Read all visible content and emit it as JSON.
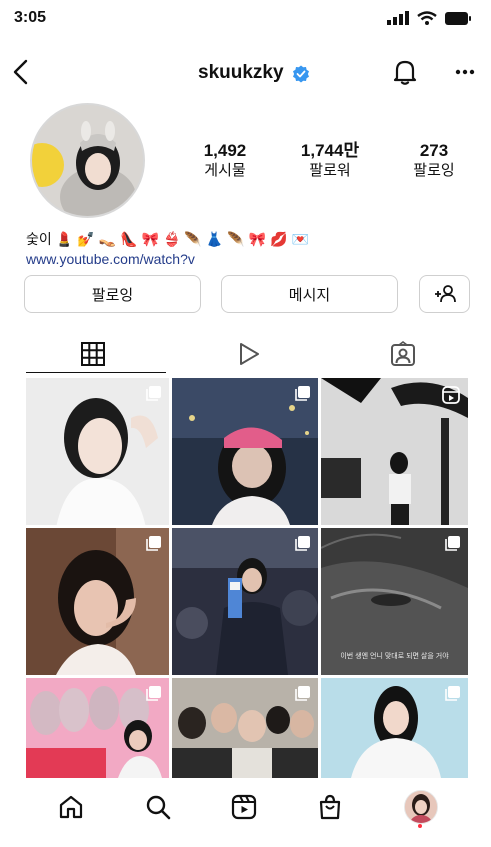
{
  "status_bar": {
    "time": "3:05"
  },
  "header": {
    "username": "skuukzky"
  },
  "profile": {
    "stats": [
      {
        "value": "1,492",
        "label": "게시물"
      },
      {
        "value": "1,744만",
        "label": "팔로워"
      },
      {
        "value": "273",
        "label": "팔로잉"
      }
    ],
    "bio_name": "숯이",
    "bio_emojis": [
      "💄",
      "💅",
      "👡",
      "👠",
      "🎀",
      "👙",
      "🪶",
      "👗",
      "🪶",
      "🎀",
      "💋",
      "💌"
    ],
    "link": "www.youtube.com/watch?v"
  },
  "actions": {
    "follow_label": "팔로잉",
    "message_label": "메시지"
  },
  "tabs": [
    {
      "name": "posts",
      "icon": "grid-icon",
      "selected": true
    },
    {
      "name": "reels",
      "icon": "reels-play-icon",
      "selected": false
    },
    {
      "name": "tagged",
      "icon": "tagged-person-icon",
      "selected": false
    }
  ],
  "grid": {
    "tile_6_caption": "이번 생엔 언니 맞대로 되면 살을 거야"
  },
  "bottom_nav": [
    "home-icon",
    "search-icon",
    "reels-icon",
    "shop-icon",
    "profile-avatar"
  ],
  "colors": {
    "verified": "#3897f0",
    "link": "#243c8a",
    "notification_dot": "#ff3040"
  }
}
